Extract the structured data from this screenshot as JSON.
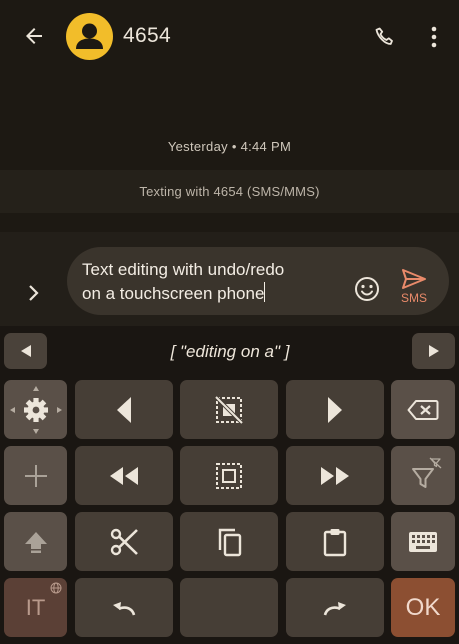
{
  "header": {
    "contact_name": "4654"
  },
  "conversation": {
    "timestamp": "Yesterday • 4:44 PM",
    "texting_info": "Texting with 4654 (SMS/MMS)"
  },
  "compose": {
    "text_line1": "Text editing with undo/redo",
    "text_line2": "on a touchscreen phone",
    "send_label": "SMS"
  },
  "keyboard": {
    "suggestion": "[ \"editing on a\" ]",
    "language_key": "IT",
    "ok_key": "OK"
  },
  "icons": {
    "back": "arrow-back-icon",
    "avatar": "person-icon",
    "call": "phone-icon",
    "more": "more-vert-icon",
    "expand": "chevron-right-icon",
    "emoji": "emoji-icon",
    "send": "send-icon"
  },
  "colors": {
    "background": "#1d1913",
    "avatar": "#f2bd2a",
    "key": "#463e36",
    "ok_key": "#8c4f32",
    "send": "#e98a6a"
  }
}
